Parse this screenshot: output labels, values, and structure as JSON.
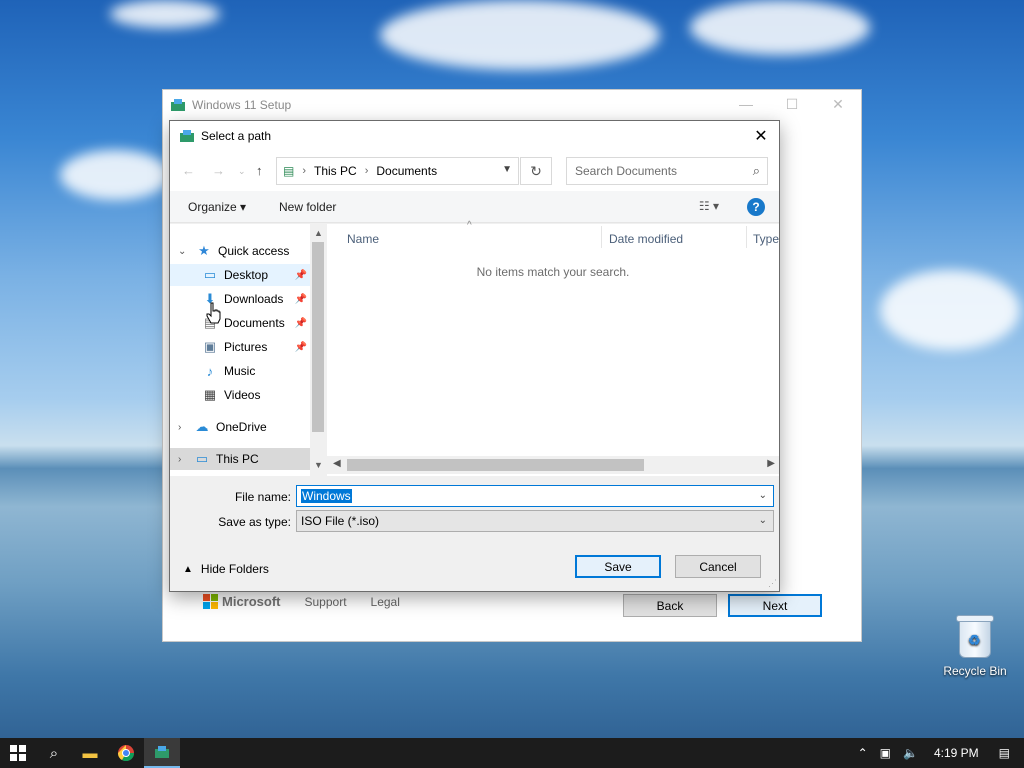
{
  "setup_window": {
    "title": "Windows 11 Setup",
    "footer": {
      "brand": "Microsoft",
      "support": "Support",
      "legal": "Legal"
    },
    "back_label": "Back",
    "next_label": "Next"
  },
  "dialog": {
    "title": "Select a path",
    "address": {
      "crumbs": [
        "This PC",
        "Documents"
      ]
    },
    "search_placeholder": "Search Documents",
    "toolbar": {
      "organize": "Organize ▾",
      "new_folder": "New folder",
      "help": "?"
    },
    "tree": [
      {
        "label": "Quick access",
        "icon": "star-icon"
      },
      {
        "label": "Desktop",
        "icon": "desktop-icon",
        "pinned": true
      },
      {
        "label": "Downloads",
        "icon": "download-icon",
        "pinned": true
      },
      {
        "label": "Documents",
        "icon": "document-icon",
        "pinned": true
      },
      {
        "label": "Pictures",
        "icon": "picture-icon",
        "pinned": true
      },
      {
        "label": "Music",
        "icon": "music-icon"
      },
      {
        "label": "Videos",
        "icon": "video-icon"
      },
      {
        "label": "OneDrive",
        "icon": "cloud-icon"
      },
      {
        "label": "This PC",
        "icon": "computer-icon"
      }
    ],
    "columns": [
      "Name",
      "Date modified",
      "Type"
    ],
    "empty_message": "No items match your search.",
    "file_name_label": "File name:",
    "file_name_value": "Windows",
    "save_type_label": "Save as type:",
    "save_type_value": "ISO File (*.iso)",
    "hide_folders": "Hide Folders",
    "save_label": "Save",
    "cancel_label": "Cancel"
  },
  "desktop": {
    "recycle_bin": "Recycle Bin"
  },
  "taskbar": {
    "time": "4:19 PM"
  },
  "colors": {
    "accent": "#0078d7",
    "taskbar": "#1c1c1c"
  }
}
